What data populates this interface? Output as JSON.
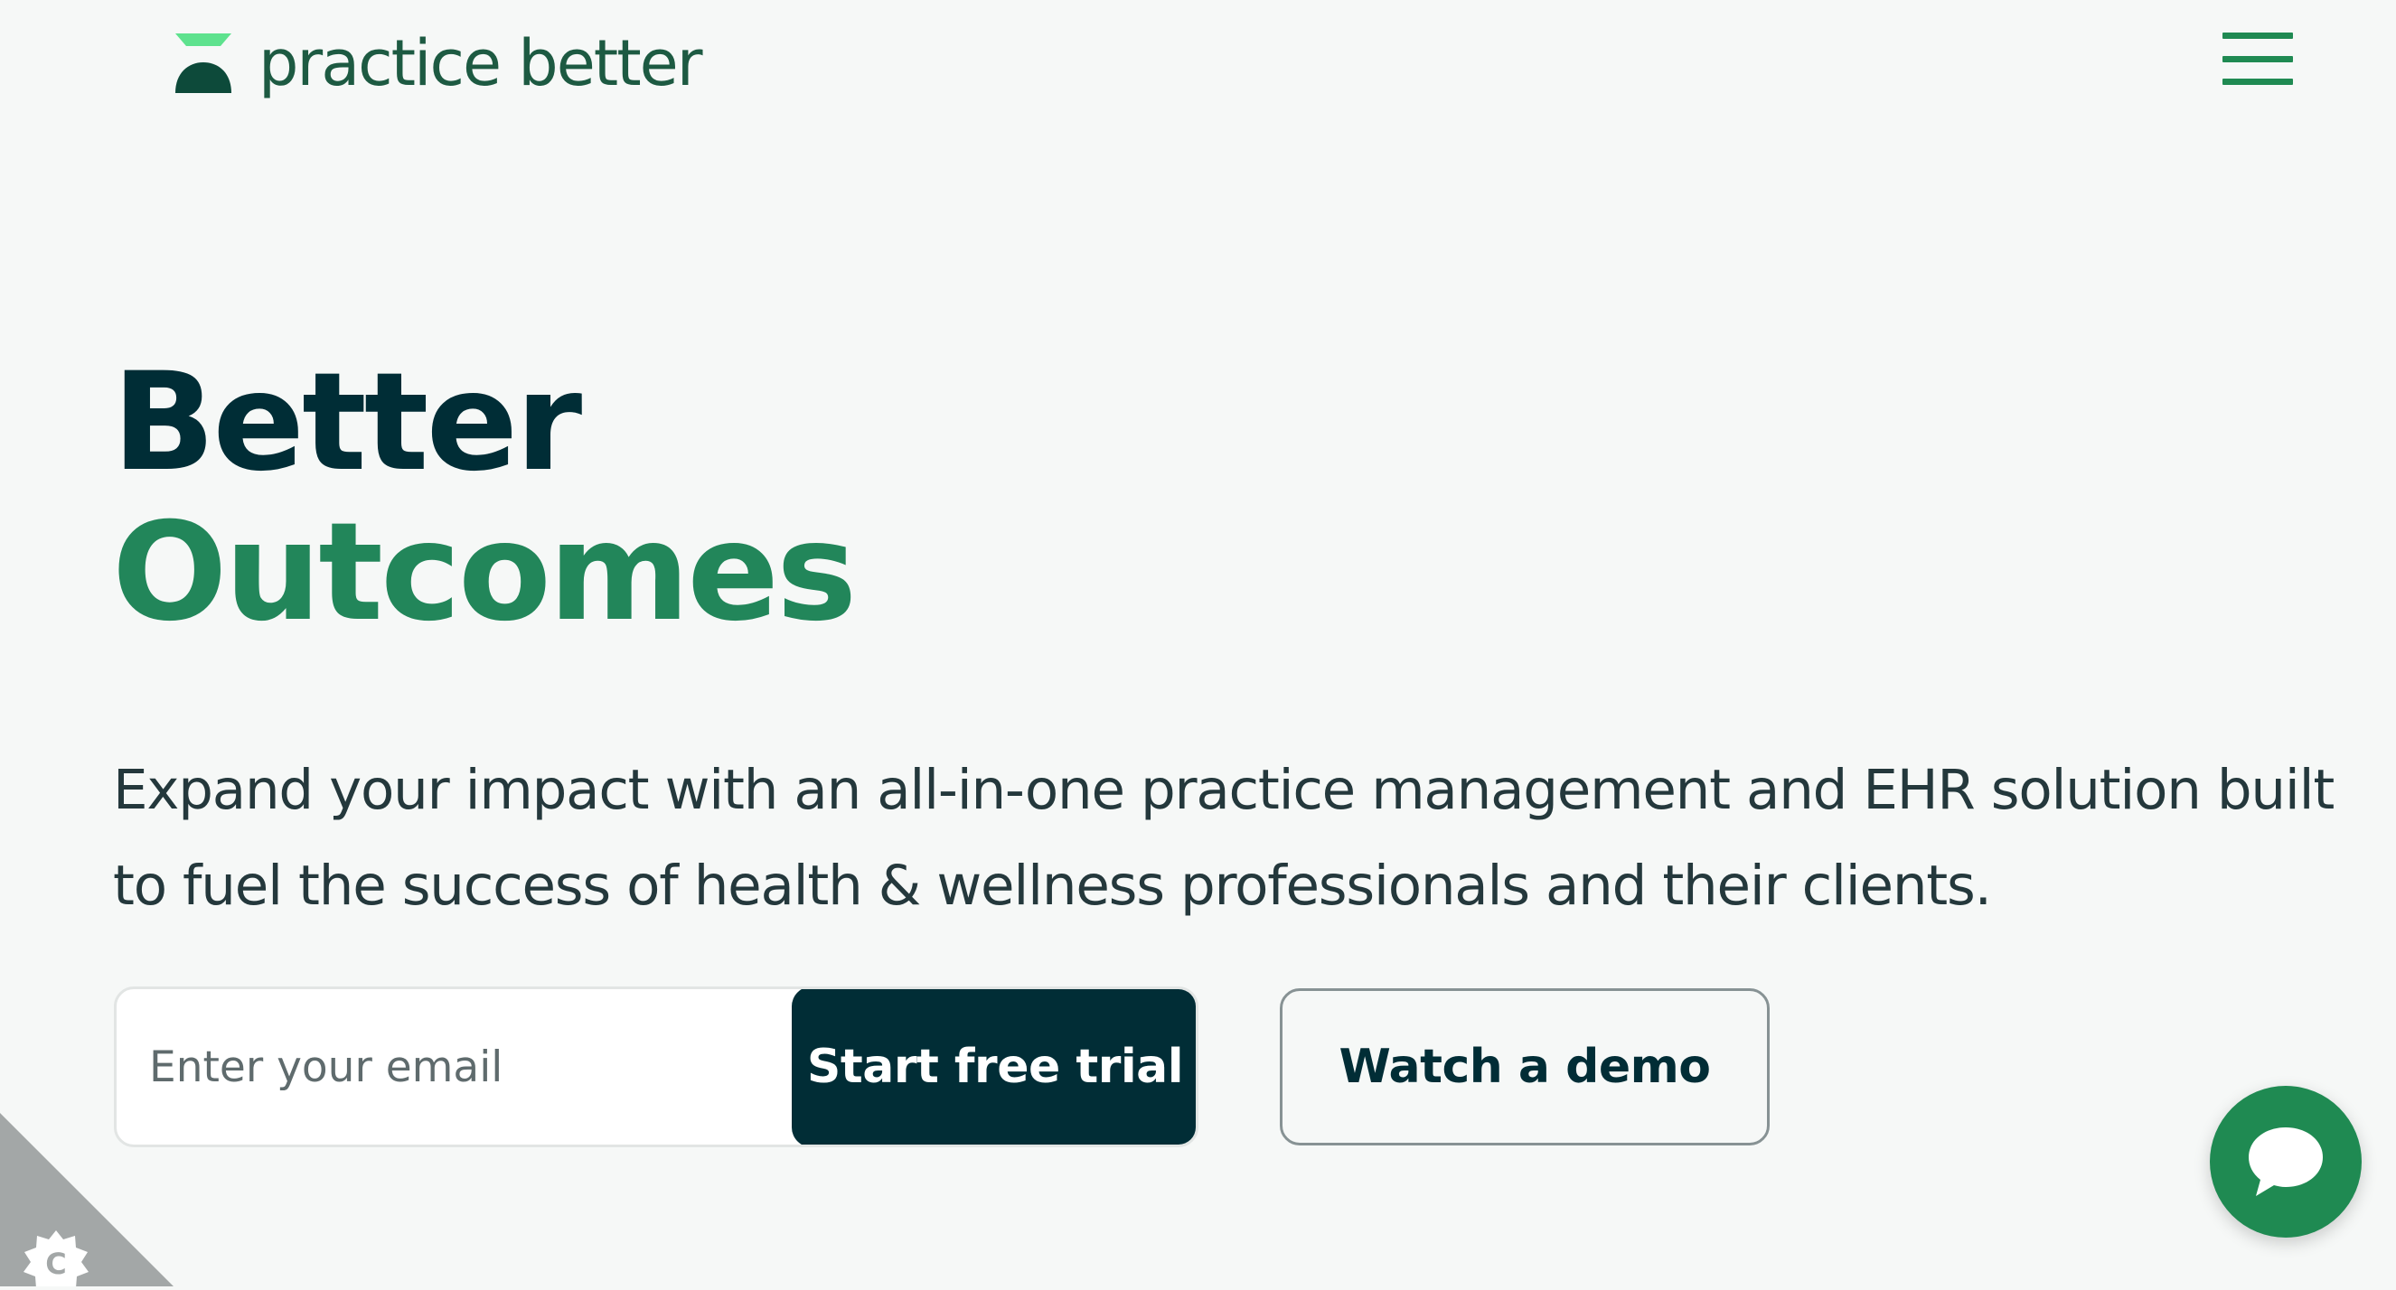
{
  "brand": {
    "name": "practice better",
    "primary_color": "#1f8a52",
    "dark_color": "#012d36",
    "accent_light": "#5ee28e"
  },
  "header": {
    "menu_icon": "hamburger-menu-icon"
  },
  "hero": {
    "title_line1": "Better",
    "title_line2": "Outcomes",
    "subtitle": "Expand your impact with an all-in-one practice management and EHR solution built to fuel the success of health & wellness professionals and their clients."
  },
  "signup": {
    "email_placeholder": "Enter your email",
    "email_value": "",
    "trial_button_label": "Start free trial"
  },
  "demo": {
    "button_label": "Watch a demo"
  },
  "widgets": {
    "chat_icon": "chat-bubble-icon",
    "cookie_icon": "cookie-settings-icon"
  }
}
